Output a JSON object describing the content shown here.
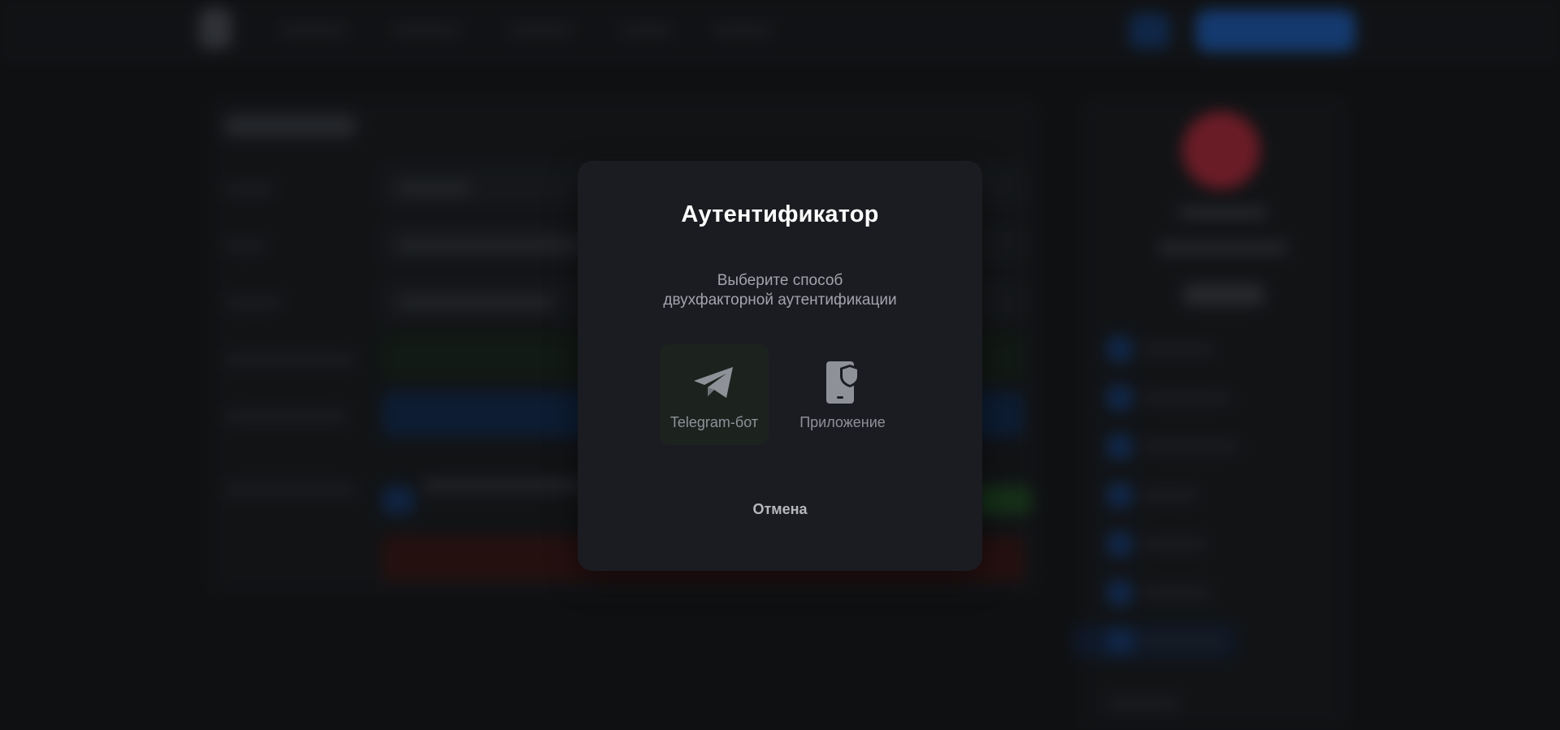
{
  "modal": {
    "title": "Аутентификатор",
    "subtitle_line1": "Выберите способ",
    "subtitle_line2": "двухфакторной аутентификации",
    "options": [
      {
        "label": "Telegram-бот",
        "icon": "telegram-paper-plane-icon",
        "selected": true
      },
      {
        "label": "Приложение",
        "icon": "phone-shield-icon",
        "selected": false
      }
    ],
    "cancel_label": "Отмена"
  },
  "colors": {
    "modal_bg": "#1b1c21",
    "title": "#ffffff",
    "subtitle": "#a3a5ac",
    "option_label": "#8f9198",
    "option_icon": "#8f9198",
    "selected_option_bg": "#1c231f",
    "accent_blue": "#1d5bb6",
    "avatar_red": "#b0283a"
  }
}
